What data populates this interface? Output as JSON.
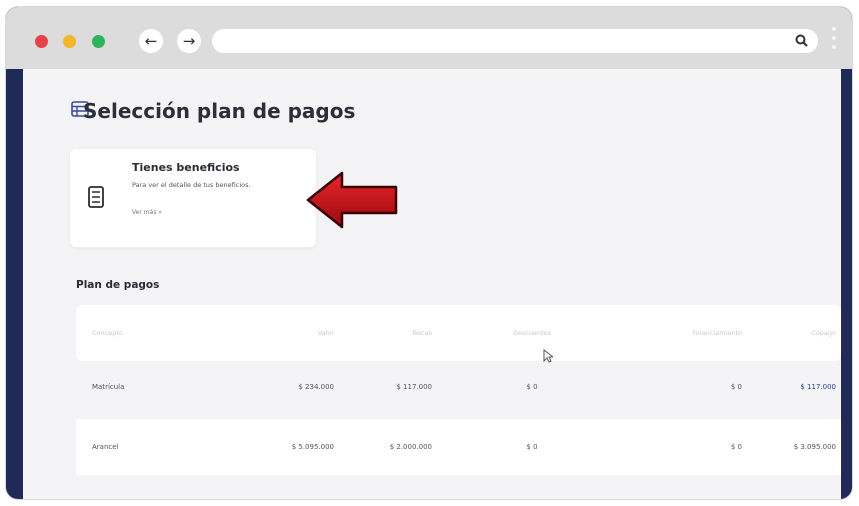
{
  "browser": {
    "url": ""
  },
  "page": {
    "title": "Selección plan de pagos"
  },
  "benefit_card": {
    "title": "Tienes beneficios",
    "description": "Para ver el detalle de tus beneficios.",
    "link": "Ver más »"
  },
  "plan": {
    "section_title": "Plan de pagos",
    "columns": [
      "Concepto",
      "Valor",
      "Becas",
      "Descuentos",
      "Financiamiento",
      "Copago"
    ],
    "rows": [
      {
        "concepto": "Matrícula",
        "valor": "$ 234.000",
        "becas": "$ 117.000",
        "descuentos": "$ 0",
        "financiamiento": "$ 0",
        "copago": "$ 117.000"
      },
      {
        "concepto": "Arancel",
        "valor": "$ 5.095.000",
        "becas": "$ 2.000.000",
        "descuentos": "$ 0",
        "financiamiento": "$ 0",
        "copago": "$ 3.095.000"
      }
    ]
  },
  "colors": {
    "frame": "#1f2a57",
    "arrow": "#c40f14",
    "accent": "#2c3a8f"
  }
}
